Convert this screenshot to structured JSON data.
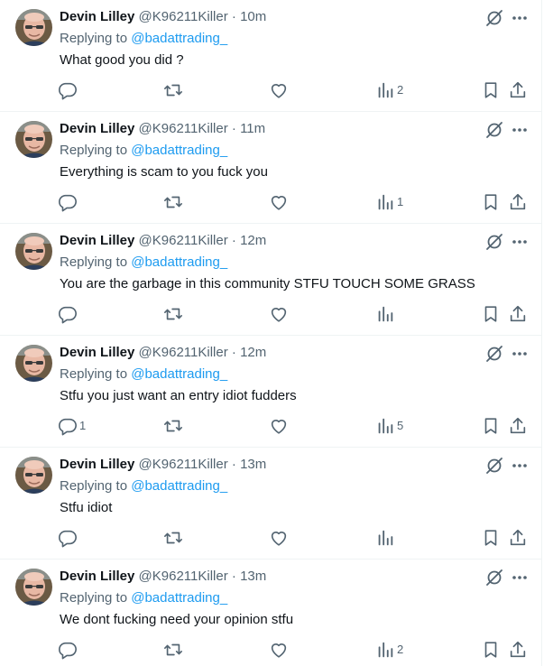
{
  "colors": {
    "text": "#0f1419",
    "secondary": "#536471",
    "link": "#1d9bf0",
    "divider": "#eff3f4"
  },
  "icons": {
    "reply": "reply-icon",
    "retweet": "retweet-icon",
    "like": "heart-icon",
    "views": "views-icon",
    "bookmark": "bookmark-icon",
    "share": "share-icon",
    "grok": "grok-icon",
    "more": "more-icon"
  },
  "tweets": [
    {
      "name": "Devin Lilley",
      "handle": "@K96211Killer",
      "sep": "·",
      "time": "10m",
      "replying_prefix": "Replying to",
      "replying_to": "@badattrading_",
      "text": "What good you did ?",
      "reply_count": "",
      "views": "2"
    },
    {
      "name": "Devin Lilley",
      "handle": "@K96211Killer",
      "sep": "·",
      "time": "11m",
      "replying_prefix": "Replying to",
      "replying_to": "@badattrading_",
      "text": "Everything is scam to you fuck you",
      "reply_count": "",
      "views": "1"
    },
    {
      "name": "Devin Lilley",
      "handle": "@K96211Killer",
      "sep": "·",
      "time": "12m",
      "replying_prefix": "Replying to",
      "replying_to": "@badattrading_",
      "text": "You are the garbage in this community STFU TOUCH SOME GRASS",
      "reply_count": "",
      "views": ""
    },
    {
      "name": "Devin Lilley",
      "handle": "@K96211Killer",
      "sep": "·",
      "time": "12m",
      "replying_prefix": "Replying to",
      "replying_to": "@badattrading_",
      "text": "Stfu you just want an entry idiot fudders",
      "reply_count": "1",
      "views": "5"
    },
    {
      "name": "Devin Lilley",
      "handle": "@K96211Killer",
      "sep": "·",
      "time": "13m",
      "replying_prefix": "Replying to",
      "replying_to": "@badattrading_",
      "text": "Stfu idiot",
      "reply_count": "",
      "views": ""
    },
    {
      "name": "Devin Lilley",
      "handle": "@K96211Killer",
      "sep": "·",
      "time": "13m",
      "replying_prefix": "Replying to",
      "replying_to": "@badattrading_",
      "text": "We dont fucking need your opinion  stfu",
      "reply_count": "",
      "views": "2"
    }
  ]
}
